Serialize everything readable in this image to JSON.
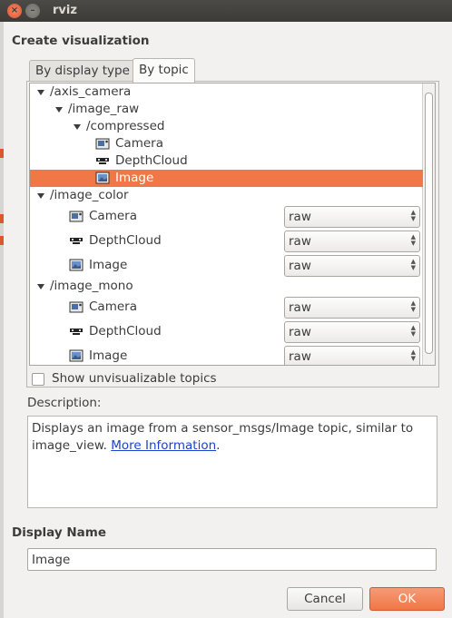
{
  "window": {
    "title": "rviz"
  },
  "dialog": {
    "group_title": "Create visualization",
    "tabs": [
      {
        "label": "By display type",
        "active": false
      },
      {
        "label": "By topic",
        "active": true
      }
    ],
    "tree": {
      "rows": [
        {
          "label": "/axis_camera",
          "kind": "topic",
          "expanded": true
        },
        {
          "label": "/image_raw",
          "kind": "topic",
          "expanded": true
        },
        {
          "label": "/compressed",
          "kind": "topic",
          "expanded": true
        },
        {
          "label": "Camera",
          "kind": "display",
          "icon": "camera-icon"
        },
        {
          "label": "DepthCloud",
          "kind": "display",
          "icon": "depthcloud-icon"
        },
        {
          "label": "Image",
          "kind": "display",
          "icon": "image-icon",
          "selected": true
        },
        {
          "label": "/image_color",
          "kind": "topic",
          "expanded": true
        },
        {
          "label": "Camera",
          "kind": "display",
          "icon": "camera-icon",
          "transport": "raw"
        },
        {
          "label": "DepthCloud",
          "kind": "display",
          "icon": "depthcloud-icon",
          "transport": "raw"
        },
        {
          "label": "Image",
          "kind": "display",
          "icon": "image-icon",
          "transport": "raw"
        },
        {
          "label": "/image_mono",
          "kind": "topic",
          "expanded": true
        },
        {
          "label": "Camera",
          "kind": "display",
          "icon": "camera-icon",
          "transport": "raw"
        },
        {
          "label": "DepthCloud",
          "kind": "display",
          "icon": "depthcloud-icon",
          "transport": "raw"
        },
        {
          "label": "Image",
          "kind": "display",
          "icon": "image-icon",
          "transport": "raw"
        }
      ]
    },
    "show_unvisualizable": {
      "label": "Show unvisualizable topics",
      "checked": false
    },
    "description": {
      "label": "Description:",
      "text": "Displays an image from a sensor_msgs/Image topic, similar to image_view.",
      "link": "More Information",
      "suffix": "."
    },
    "display_name": {
      "label": "Display Name",
      "value": "Image"
    },
    "buttons": {
      "cancel": "Cancel",
      "ok": "OK"
    }
  },
  "colors": {
    "accent": "#f07746",
    "link": "#1d41d0",
    "titlebar": "#3c3b37"
  }
}
